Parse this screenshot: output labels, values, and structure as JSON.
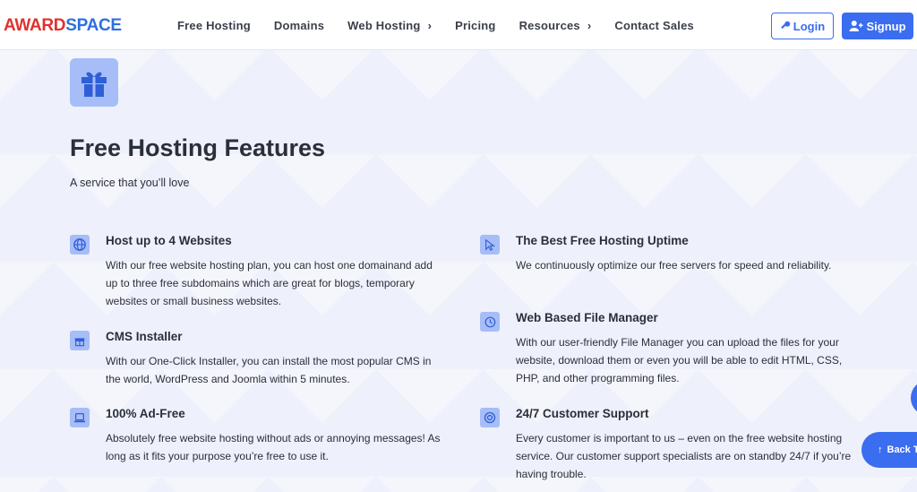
{
  "nav": {
    "logo_part1": "AWARD",
    "logo_part2": "SPACE",
    "links": [
      {
        "label": "Free Hosting"
      },
      {
        "label": "Domains"
      },
      {
        "label": "Web Hosting",
        "has_chevron": true
      },
      {
        "label": "Pricing"
      },
      {
        "label": "Resources",
        "has_chevron": true
      },
      {
        "label": "Contact Sales"
      }
    ],
    "login_label": "Login",
    "signup_label": "Signup"
  },
  "hero": {
    "icon": "gift-icon",
    "title": "Free Hosting Features",
    "subtitle": "A service that you’ll love"
  },
  "features": [
    {
      "icon": "globe-icon",
      "title": "Host up to 4 Websites",
      "text": "With our free website hosting plan, you can host one domainand add up to three free subdomains which are great for blogs, temporary websites or small business websites."
    },
    {
      "icon": "gift-icon",
      "title": "CMS Installer",
      "text": "With our One-Click Installer, you can install the most popular CMS in the world, WordPress and Joomla within 5 minutes."
    },
    {
      "icon": "laptop-icon",
      "title": "100% Ad-Free",
      "text": "Absolutely free website hosting without ads or annoying messages! As long as it fits your purpose you’re free to use it."
    },
    {
      "icon": "cursor-icon",
      "title": "The Best Free Hosting Uptime",
      "text": "We continuously optimize our free servers for speed and reliability."
    },
    {
      "icon": "history-icon",
      "title": "Web Based File Manager",
      "text": "With our user-friendly File Manager you can upload the files for your website, download them or even you will be able to edit HTML, CSS, PHP, and other programming files."
    },
    {
      "icon": "lifebuoy-icon",
      "title": "24/7 Customer Support",
      "text": "Every customer is important to us – even on the free website hosting service. Our customer support specialists are on standby 24/7 if you’re having trouble."
    }
  ],
  "back_to_top": "Back T",
  "colors": {
    "accent": "#3b6df0",
    "icon_bg": "#a7bdf7",
    "logo_red": "#e0312f",
    "logo_blue": "#2e6fe0"
  }
}
